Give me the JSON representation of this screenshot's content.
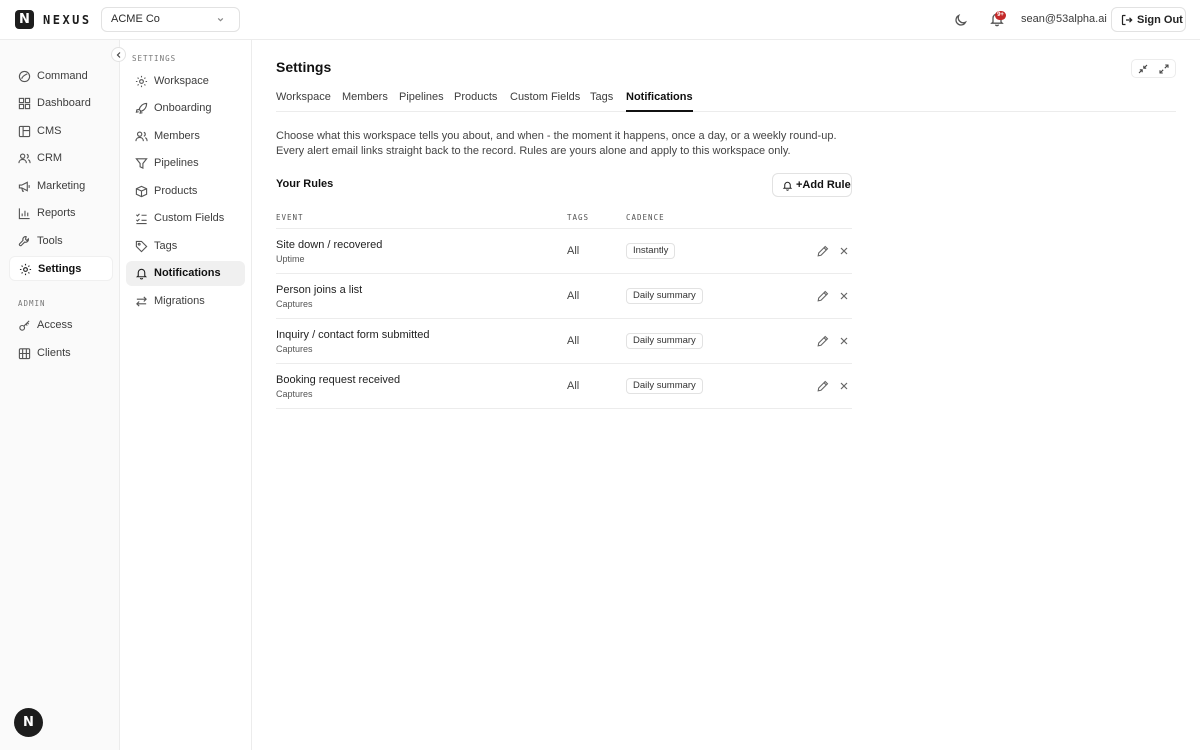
{
  "brand": {
    "mark": "N",
    "name": "NEXUS"
  },
  "workspace_select": {
    "value": "ACME Co"
  },
  "header": {
    "notification_badge": "9+",
    "user_email": "sean@53alpha.ai",
    "sign_out_label": "Sign Out"
  },
  "sidebar": {
    "items": [
      {
        "label": "Command",
        "icon": "command-icon"
      },
      {
        "label": "Dashboard",
        "icon": "dashboard-icon"
      },
      {
        "label": "CMS",
        "icon": "cms-icon"
      },
      {
        "label": "CRM",
        "icon": "users-icon"
      },
      {
        "label": "Marketing",
        "icon": "megaphone-icon"
      },
      {
        "label": "Reports",
        "icon": "bar-chart-icon"
      },
      {
        "label": "Tools",
        "icon": "wrench-icon"
      },
      {
        "label": "Settings",
        "icon": "gear-icon",
        "active": true
      }
    ],
    "admin_label": "ADMIN",
    "admin_items": [
      {
        "label": "Access",
        "icon": "key-icon"
      },
      {
        "label": "Clients",
        "icon": "building-icon"
      }
    ],
    "avatar": "N"
  },
  "subnav": {
    "label": "SETTINGS",
    "items": [
      {
        "label": "Workspace",
        "icon": "gear-icon"
      },
      {
        "label": "Onboarding",
        "icon": "rocket-icon"
      },
      {
        "label": "Members",
        "icon": "users-icon"
      },
      {
        "label": "Pipelines",
        "icon": "funnel-icon"
      },
      {
        "label": "Products",
        "icon": "package-icon"
      },
      {
        "label": "Custom Fields",
        "icon": "list-checks-icon"
      },
      {
        "label": "Tags",
        "icon": "tag-icon"
      },
      {
        "label": "Notifications",
        "icon": "bell-icon",
        "active": true
      },
      {
        "label": "Migrations",
        "icon": "arrows-swap-icon"
      }
    ]
  },
  "main": {
    "title": "Settings",
    "tabs": [
      {
        "label": "Workspace"
      },
      {
        "label": "Members"
      },
      {
        "label": "Pipelines"
      },
      {
        "label": "Products"
      },
      {
        "label": "Custom Fields"
      },
      {
        "label": "Tags"
      },
      {
        "label": "Notifications",
        "active": true
      }
    ],
    "description": "Choose what this workspace tells you about, and when - the moment it happens, once a day, or a weekly round-up. Every alert email links straight back to the record. Rules are yours alone and apply to this workspace only.",
    "rules_title": "Your Rules",
    "add_rule_label": "+Add Rule",
    "table": {
      "columns": {
        "event": "EVENT",
        "tags": "TAGS",
        "cadence": "CADENCE"
      },
      "rows": [
        {
          "event": "Site down / recovered",
          "source": "Uptime",
          "tags": "All",
          "cadence": "Instantly"
        },
        {
          "event": "Person joins a list",
          "source": "Captures",
          "tags": "All",
          "cadence": "Daily summary"
        },
        {
          "event": "Inquiry / contact form submitted",
          "source": "Captures",
          "tags": "All",
          "cadence": "Daily summary"
        },
        {
          "event": "Booking request received",
          "source": "Captures",
          "tags": "All",
          "cadence": "Daily summary"
        }
      ]
    }
  },
  "colors": {
    "accent": "#111111",
    "badge_red": "#c42a2a",
    "border": "#ececec",
    "sidebar_bg": "#fafafa"
  }
}
